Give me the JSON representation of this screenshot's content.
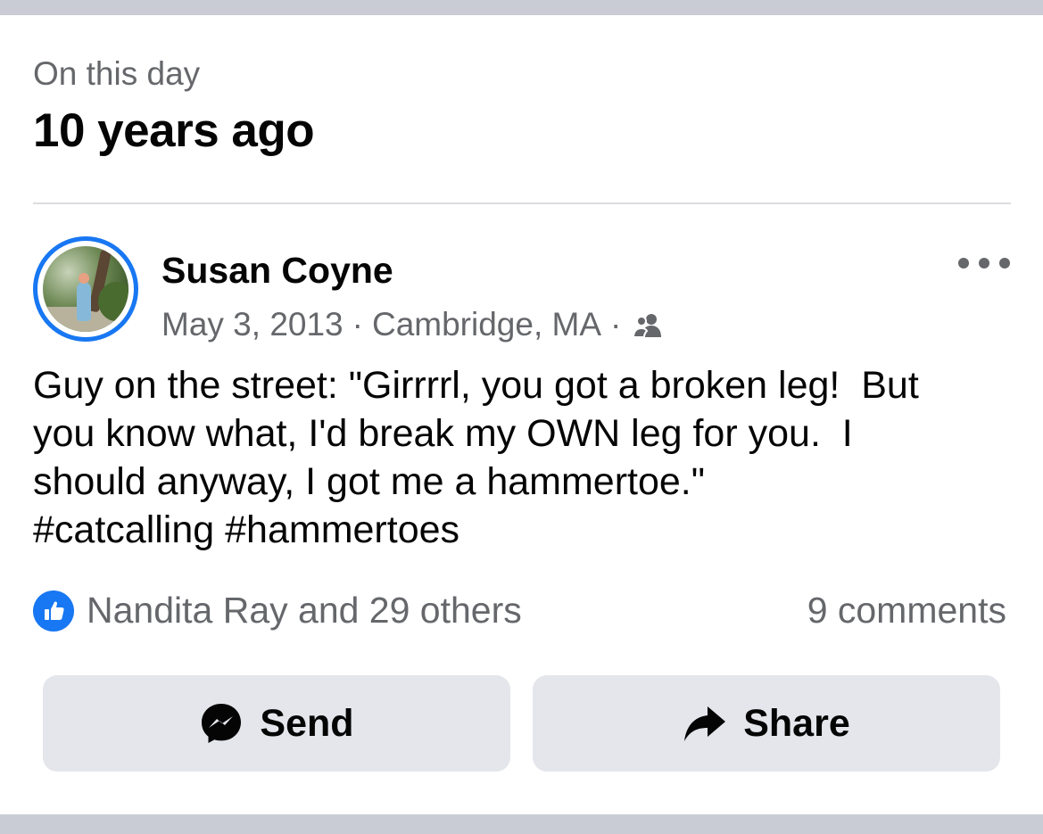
{
  "memory": {
    "eyebrow": "On this day",
    "headline": "10 years ago"
  },
  "post": {
    "author": "Susan Coyne",
    "date": "May 3, 2013",
    "separator": "·",
    "location": "Cambridge, MA",
    "audience_icon": "friends-icon",
    "more_icon": "more-options-icon",
    "text_lines": [
      "Guy on the street: \"Girrrrl, you got a broken leg!  But",
      "you know what, I'd break my OWN leg for you.  I",
      "should anyway, I got me a hammertoe.\"",
      "#catcalling #hammertoes"
    ]
  },
  "engagement": {
    "likes_text": "Nandita Ray and 29 others",
    "comments_text": "9 comments",
    "like_icon": "thumbs-up-icon"
  },
  "actions": {
    "send_label": "Send",
    "share_label": "Share",
    "send_icon": "messenger-icon",
    "share_icon": "share-arrow-icon"
  },
  "colors": {
    "accent": "#1877f2",
    "secondary_text": "#65676b",
    "button_bg": "#e4e6eb",
    "band": "#c9ccd4"
  }
}
